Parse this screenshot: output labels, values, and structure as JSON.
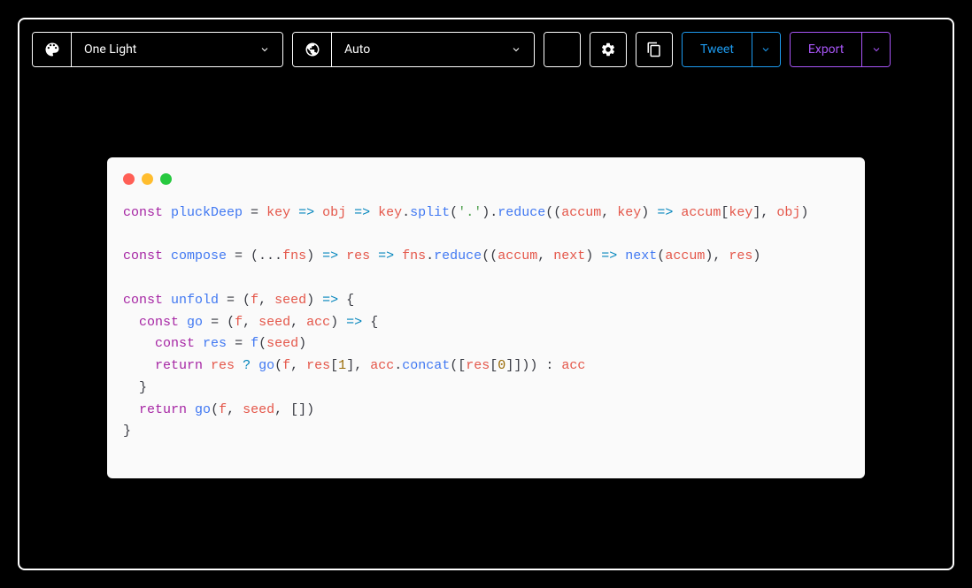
{
  "toolbar": {
    "theme_select": "One Light",
    "language_select": "Auto",
    "tweet_label": "Tweet",
    "export_label": "Export"
  },
  "editor": {
    "code": {
      "l1": {
        "kw": "const",
        "name": "pluckDeep",
        "eq": " = ",
        "a1": "key",
        "arr1": " => ",
        "a2": "obj",
        "arr2": " => ",
        "v1": "key",
        "dot1": ".",
        "m1": "split",
        "p1": "(",
        "s1": "'.'",
        "p2": ").",
        "m2": "reduce",
        "p3": "((",
        "a3": "accum",
        "c1": ", ",
        "a4": "key",
        "p4": ")",
        "arr3": " => ",
        "v2": "accum",
        "br1": "[",
        "v3": "key",
        "br2": "], ",
        "v4": "obj",
        "p5": ")"
      },
      "l2": {
        "kw": "const",
        "name": "compose",
        "eq": " = (...",
        "a1": "fns",
        "p1": ")",
        "arr1": " => ",
        "a2": "res",
        "arr2": " => ",
        "v1": "fns",
        "dot": ".",
        "m1": "reduce",
        "p2": "((",
        "a3": "accum",
        "c1": ", ",
        "a4": "next",
        "p3": ")",
        "arr3": " => ",
        "fn": "next",
        "p4": "(",
        "v2": "accum",
        "p5": "), ",
        "v3": "res",
        "p6": ")"
      },
      "l3": {
        "kw": "const",
        "name": "unfold",
        "eq": " = (",
        "a1": "f",
        "c1": ", ",
        "a2": "seed",
        "p1": ")",
        "arr": " => ",
        "brace": "{"
      },
      "l4": {
        "indent": "  ",
        "kw": "const",
        "name": "go",
        "eq": " = (",
        "a1": "f",
        "c1": ", ",
        "a2": "seed",
        "c2": ", ",
        "a3": "acc",
        "p1": ")",
        "arr": " => ",
        "brace": "{"
      },
      "l5": {
        "indent": "    ",
        "kw": "const",
        "name": "res",
        "eq": " = ",
        "fn": "f",
        "p1": "(",
        "v1": "seed",
        "p2": ")"
      },
      "l6": {
        "indent": "    ",
        "kw": "return",
        "sp": " ",
        "v1": "res",
        "q": " ? ",
        "fn": "go",
        "p1": "(",
        "v2": "f",
        "c1": ", ",
        "v3": "res",
        "br1": "[",
        "n1": "1",
        "br2": "], ",
        "v4": "acc",
        "dot": ".",
        "m1": "concat",
        "p2": "([",
        "v5": "res",
        "br3": "[",
        "n2": "0",
        "br4": "]])) : ",
        "v6": "acc"
      },
      "l7": {
        "indent": "  ",
        "brace": "}"
      },
      "l8": {
        "indent": "  ",
        "kw": "return",
        "sp": " ",
        "fn": "go",
        "p1": "(",
        "v1": "f",
        "c1": ", ",
        "v2": "seed",
        "c2": ", [])"
      },
      "l9": {
        "brace": "}"
      }
    }
  }
}
